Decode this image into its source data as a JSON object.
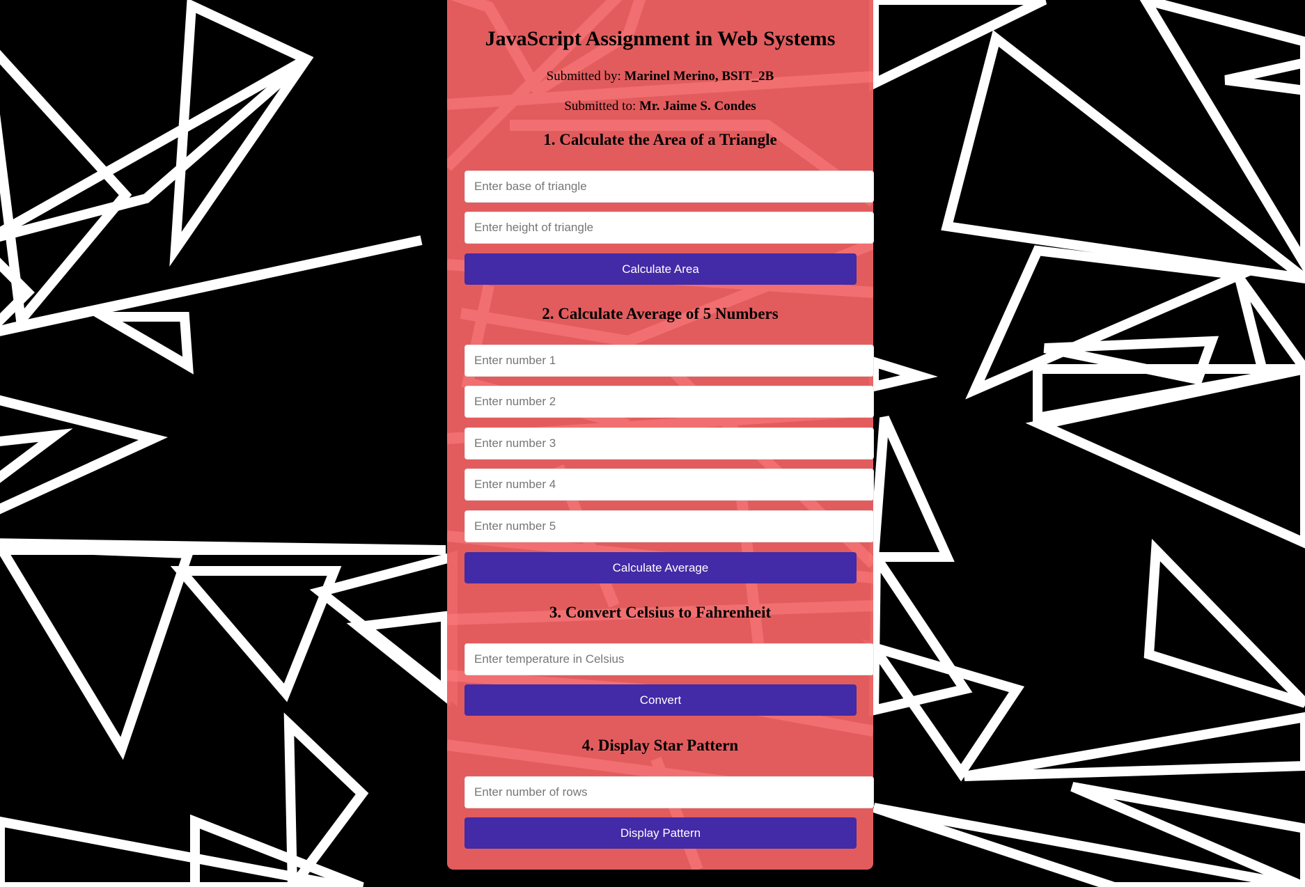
{
  "page": {
    "title": "JavaScript Assignment in Web Systems",
    "submitted_by_label": "Submitted by:",
    "submitted_by_name": "Marinel Merino, BSIT_2B",
    "submitted_to_label": "Submitted to:",
    "submitted_to_name": "Mr. Jaime S. Condes"
  },
  "sections": {
    "triangle": {
      "heading": "1. Calculate the Area of a Triangle",
      "base_placeholder": "Enter base of triangle",
      "height_placeholder": "Enter height of triangle",
      "button": "Calculate Area"
    },
    "average": {
      "heading": "2. Calculate Average of 5 Numbers",
      "placeholders": [
        "Enter number 1",
        "Enter number 2",
        "Enter number 3",
        "Enter number 4",
        "Enter number 5"
      ],
      "button": "Calculate Average"
    },
    "celsius": {
      "heading": "3. Convert Celsius to Fahrenheit",
      "placeholder": "Enter temperature in Celsius",
      "button": "Convert"
    },
    "stars": {
      "heading": "4. Display Star Pattern",
      "placeholder": "Enter number of rows",
      "button": "Display Pattern"
    }
  },
  "colors": {
    "panel": "#eb6062",
    "button": "#432aa6",
    "background": "#000000",
    "pattern_lines": "#ffffff"
  }
}
